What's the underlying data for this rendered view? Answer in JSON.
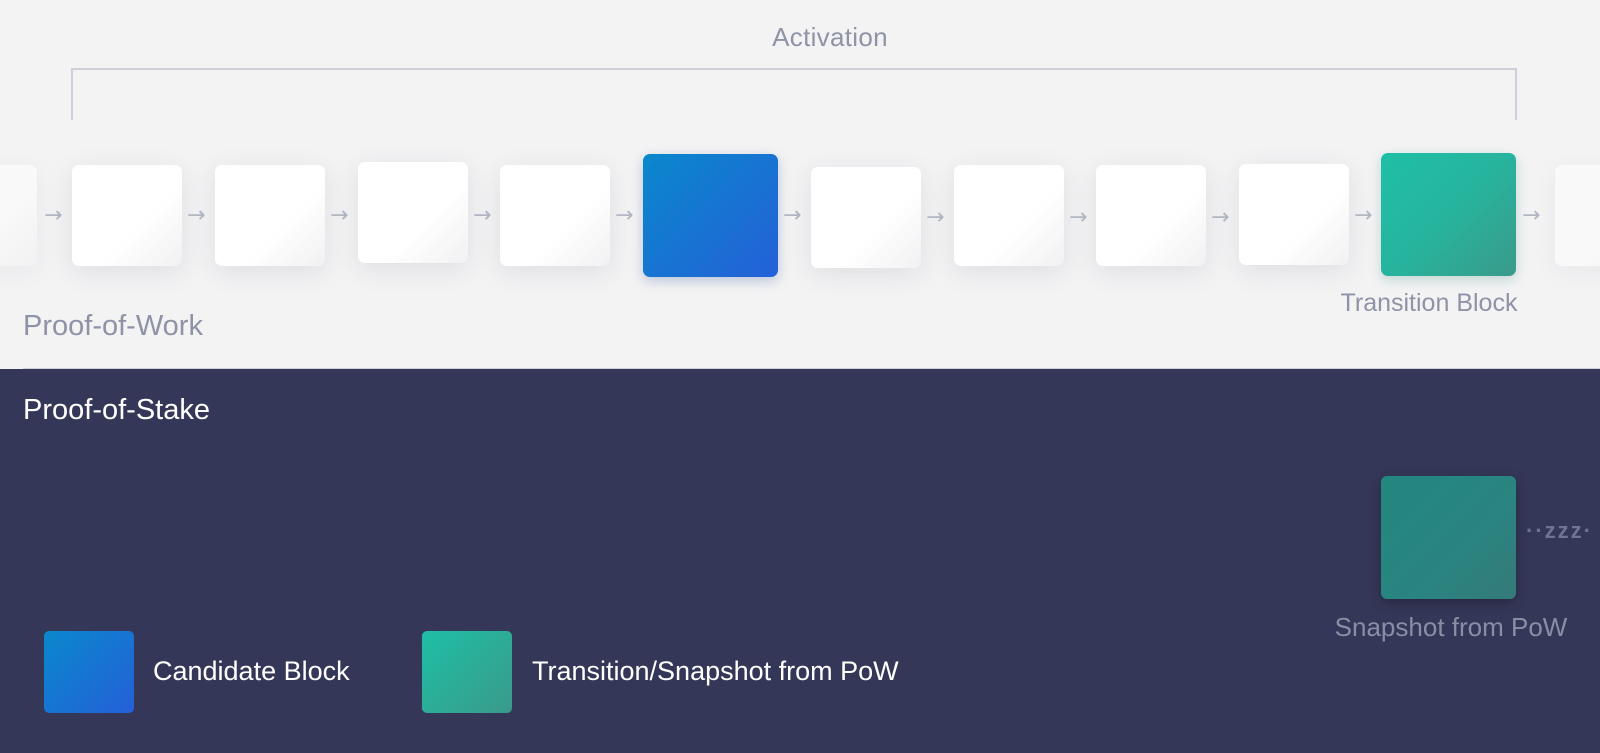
{
  "activation_label": "Activation",
  "pow_label": "Proof-of-Work",
  "pos_label": "Proof-of-Stake",
  "transition_block_label": "Transition Block",
  "snapshot_label": "Snapshot from PoW",
  "sleep_text": "··zzz·",
  "colors": {
    "pow_background": "#f3f3f4",
    "pos_background": "#343757",
    "candidate_gradient": [
      "#0a88cc",
      "#2460d8"
    ],
    "transition_gradient": [
      "#1ebfa6",
      "#3a9a8a"
    ]
  },
  "chain_blocks": [
    {
      "type": "white-faded"
    },
    {
      "type": "white"
    },
    {
      "type": "white"
    },
    {
      "type": "white"
    },
    {
      "type": "white"
    },
    {
      "type": "candidate"
    },
    {
      "type": "white"
    },
    {
      "type": "white"
    },
    {
      "type": "white"
    },
    {
      "type": "white"
    },
    {
      "type": "transition"
    },
    {
      "type": "white-faded"
    }
  ],
  "legend": [
    {
      "type": "candidate",
      "label": "Candidate Block"
    },
    {
      "type": "transition",
      "label": "Transition/Snapshot from PoW"
    }
  ]
}
